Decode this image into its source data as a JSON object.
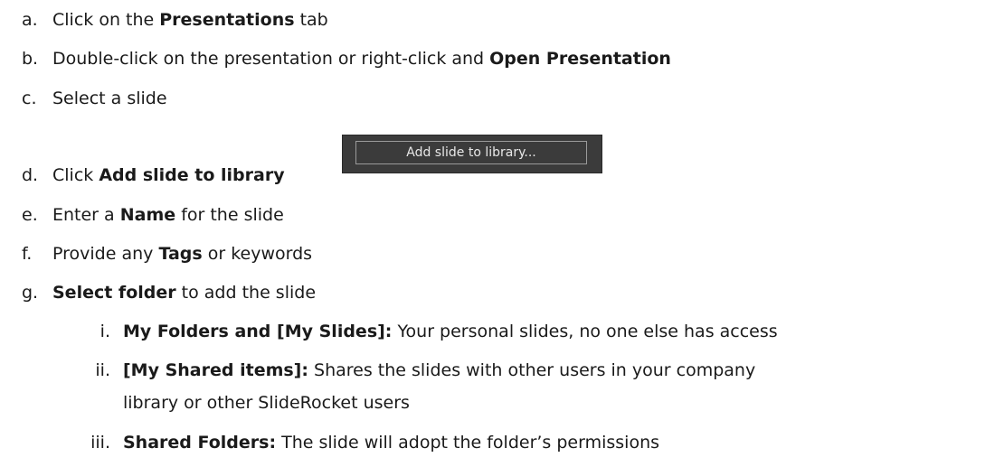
{
  "steps": [
    {
      "marker": "a.",
      "parts": [
        {
          "t": "Click on the ",
          "b": false
        },
        {
          "t": "Presentations",
          "b": true
        },
        {
          "t": " tab",
          "b": false
        }
      ]
    },
    {
      "marker": "b.",
      "parts": [
        {
          "t": "Double-click on the presentation or right-click and ",
          "b": false
        },
        {
          "t": "Open Presentation",
          "b": true
        }
      ]
    },
    {
      "marker": "c.",
      "parts": [
        {
          "t": "Select a slide",
          "b": false
        }
      ]
    },
    {
      "marker": "d.",
      "parts": [
        {
          "t": "Click ",
          "b": false
        },
        {
          "t": "Add slide to library",
          "b": true
        }
      ]
    },
    {
      "marker": "e.",
      "parts": [
        {
          "t": "Enter a ",
          "b": false
        },
        {
          "t": "Name",
          "b": true
        },
        {
          "t": " for the slide",
          "b": false
        }
      ]
    },
    {
      "marker": "f.",
      "parts": [
        {
          "t": "Provide any ",
          "b": false
        },
        {
          "t": "Tags",
          "b": true
        },
        {
          "t": " or keywords",
          "b": false
        }
      ]
    },
    {
      "marker": "g.",
      "parts": [
        {
          "t": "Select folder",
          "b": true
        },
        {
          "t": " to add the slide",
          "b": false
        }
      ]
    }
  ],
  "substeps": [
    {
      "marker": "i.",
      "parts": [
        {
          "t": "My Folders and [My Slides]:",
          "b": true
        },
        {
          "t": " Your personal slides, no one else has access",
          "b": false
        }
      ]
    },
    {
      "marker": "ii.",
      "parts": [
        {
          "t": "[My Shared items]:",
          "b": true
        },
        {
          "t": " Shares the slides with other users in your company",
          "b": false
        }
      ],
      "continuation": "library or other SlideRocket users"
    },
    {
      "marker": "iii.",
      "parts": [
        {
          "t": "Shared Folders:",
          "b": true
        },
        {
          "t": " The slide will adopt the folder’s permissions",
          "b": false
        }
      ]
    }
  ],
  "ui_button": {
    "label": "Add slide to library..."
  }
}
